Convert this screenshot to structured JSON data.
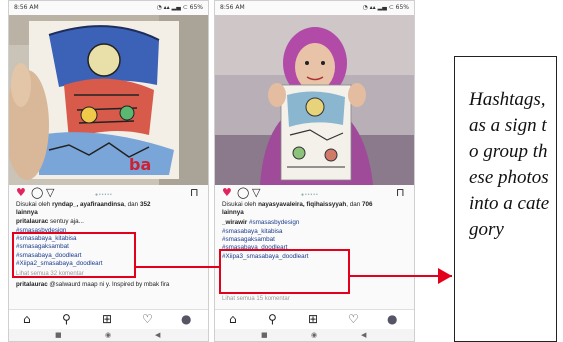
{
  "left_phone": {
    "status_time": "8:56 AM",
    "status_icons": "◔ ▴▴ ▂▄ ⊂ 65%",
    "likes": {
      "prefix": "Disukai oleh ",
      "users": "ryndap_, ayafiraandinsa",
      "mid": ", dan ",
      "count": "352",
      "suffix": "lainnya"
    },
    "caption": {
      "user": "pritalaurac",
      "text": "sentuy aja..."
    },
    "hashtags": [
      "#smasasbydesign",
      "#smasabaya_kitabisa",
      "#smasagaksambat",
      "#smasabaya_doodleart",
      "#Xiipa2_smasabaya_doodleart"
    ],
    "comments_link": "Lihat semua 32 komentar",
    "comment": {
      "user": "pritalaurac",
      "text": "@salwaurd maap ni y. Inspired by mbak fira"
    }
  },
  "right_phone": {
    "status_time": "8:56 AM",
    "status_icons": "◔ ▴▴ ▂▄ ⊂ 65%",
    "likes": {
      "prefix": "Disukai oleh ",
      "users": "nayasyavaleira, fiqihaissyyah",
      "mid": ", dan ",
      "count": "706",
      "suffix": "lainnya"
    },
    "caption": {
      "user": "_wirawir",
      "text": "#smasasbydesign"
    },
    "hashtags": [
      "#smasabaya_kitabisa",
      "#smasagaksambat",
      "#smasabaya_doodleart",
      "#Xiipa3_smasabaya_doodleart"
    ],
    "comments_link": "Lihat semua 15 komentar"
  },
  "note": {
    "text": "Hashtags, as a sign to group these photos into a category"
  },
  "colors": {
    "highlight": "#e3001b",
    "hashtag": "#1a3b8c",
    "heart": "#e0245e"
  },
  "icons": {
    "heart": "♥",
    "comment": "◯",
    "share": "▽",
    "bookmark": "⊓",
    "home": "⌂",
    "search": "⚲",
    "add": "⊞",
    "activity": "♡",
    "profile": "●",
    "sys_square": "■",
    "sys_circle": "◉",
    "sys_back": "◀"
  }
}
